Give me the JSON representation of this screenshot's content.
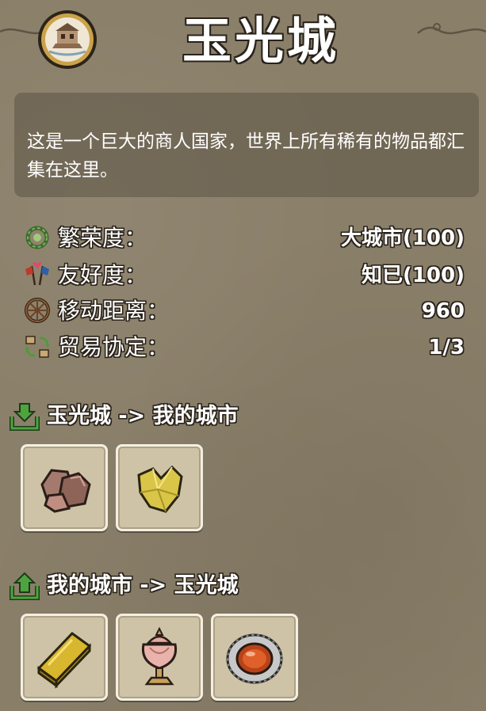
{
  "city": {
    "name": "玉光城",
    "emblem_icon": "harbor-emblem-icon"
  },
  "description": "这是一个巨大的商人国家，世界上所有稀有的物品都汇集在这里。",
  "stats": [
    {
      "icon": "prosperity-wreath-icon",
      "label": "繁荣度：",
      "value": "大城市(100)"
    },
    {
      "icon": "friendship-flags-icon",
      "label": "友好度：",
      "value": "知已(100)"
    },
    {
      "icon": "wheel-icon",
      "label": "移动距离：",
      "value": "960"
    },
    {
      "icon": "trade-agreement-icon",
      "label": "贸易协定：",
      "value": "1/3"
    }
  ],
  "imports": {
    "label": "玉光城 -> 我的城市",
    "icon": "download-tray-icon",
    "items": [
      "copper-ore-icon",
      "gold-ore-icon"
    ]
  },
  "exports": {
    "label": "我的城市 -> 玉光城",
    "icon": "upload-tray-icon",
    "items": [
      "gold-bar-icon",
      "ornate-censer-icon",
      "ruby-brooch-icon"
    ]
  },
  "colors": {
    "background": "#8a7f69",
    "panel": "#5c5446",
    "slot": "#cec3a6",
    "text": "#ffffff",
    "outline": "#2a231b",
    "accent_green": "#3f8a3a"
  }
}
